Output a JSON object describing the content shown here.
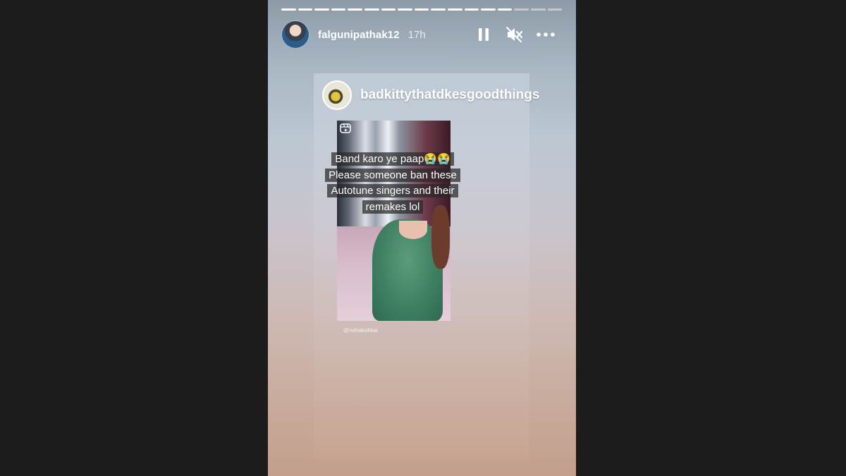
{
  "story": {
    "progress": {
      "segments_total": 17,
      "segments_done": 14
    },
    "header": {
      "username": "falgunipathak12",
      "time": "17h",
      "controls": [
        {
          "icon": "pause-icon"
        },
        {
          "icon": "muted-speaker-icon"
        },
        {
          "icon": "more-options-icon"
        }
      ]
    },
    "reposted_post": {
      "username": "badkittythatdkesgoodthings",
      "caption_lines": [
        "Band karo ye paap😭😭",
        "Please someone ban these",
        "Autotune singers and their",
        "remakes lol"
      ],
      "tag": "@nehakakkar"
    }
  },
  "colors": {
    "page_background": "#1c1c1c",
    "text": "#ffffff"
  }
}
